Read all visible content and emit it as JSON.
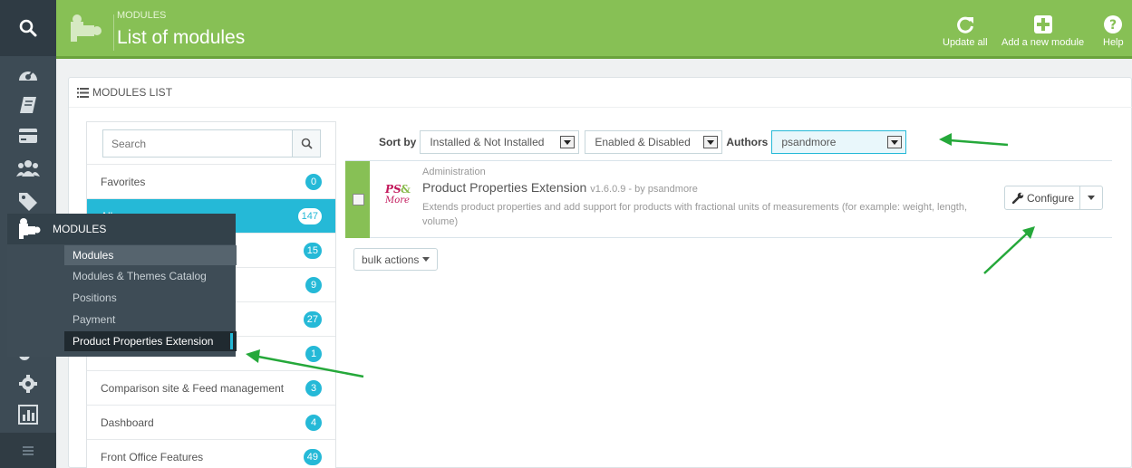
{
  "header": {
    "breadcrumb": "MODULES",
    "title": "List of modules",
    "actions": [
      {
        "label": "Update all",
        "icon": "refresh-icon"
      },
      {
        "label": "Add a new module",
        "icon": "plus-square-icon"
      },
      {
        "label": "Help",
        "icon": "help-icon"
      }
    ],
    "colors": {
      "header_bg": "#87c055",
      "accent": "#25b9d7",
      "sidebar": "#3d4b55"
    }
  },
  "panel": {
    "heading": "MODULES LIST"
  },
  "categories": {
    "search_placeholder": "Search",
    "items": [
      {
        "label": "Favorites",
        "count": "0"
      },
      {
        "label": "All",
        "count": "147"
      },
      {
        "label": "",
        "count": "15"
      },
      {
        "label": "",
        "count": "9"
      },
      {
        "label": "",
        "count": "27"
      },
      {
        "label": "",
        "count": "1"
      },
      {
        "label": "Comparison site & Feed management",
        "count": "3"
      },
      {
        "label": "Dashboard",
        "count": "4"
      },
      {
        "label": "Front Office Features",
        "count": "49"
      }
    ]
  },
  "flyout": {
    "title": "MODULES",
    "items": [
      "Modules",
      "Modules & Themes Catalog",
      "Positions",
      "Payment",
      "Product Properties Extension"
    ]
  },
  "sortbar": {
    "sort_label": "Sort by",
    "installed_select": "Installed & Not Installed",
    "enabled_select": "Enabled & Disabled",
    "authors_label": "Authors",
    "authors_select": "psandmore"
  },
  "module": {
    "category": "Administration",
    "name": "Product Properties Extension",
    "version": "v1.6.0.9 - by psandmore",
    "description": "Extends product properties and add support for products with fractional units of measurements (for example: weight, length, volume)",
    "logo": {
      "line1": "PS",
      "amp": "&",
      "line2": "More"
    },
    "configure_label": "Configure"
  },
  "bulk_actions": "bulk actions"
}
